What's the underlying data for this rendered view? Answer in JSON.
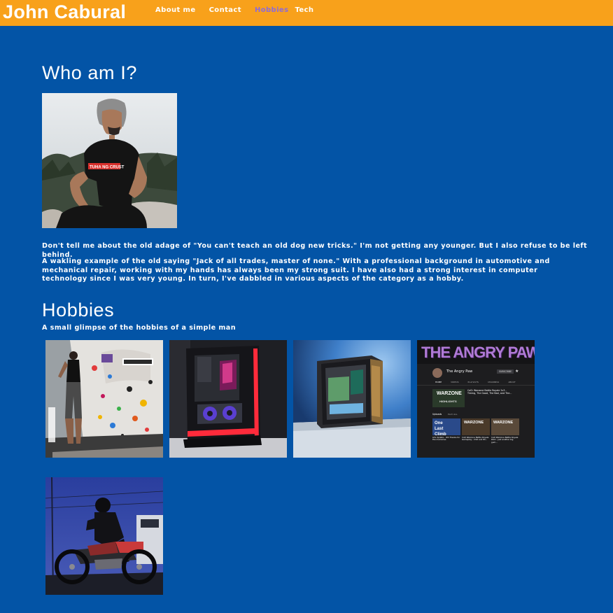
{
  "navbar": {
    "brand": "John Cabural",
    "links": [
      {
        "label": "About me"
      },
      {
        "label": "Contact"
      },
      {
        "label": "Hobbies"
      },
      {
        "label": "Tech"
      }
    ],
    "active_link_color": "#8c6bd8",
    "background_color": "#f8a11b"
  },
  "page": {
    "background_color": "#0354a6"
  },
  "about": {
    "title": "Who am I?",
    "portrait_shirt_text": "TUHA NG CRUST",
    "paragraph_1": "Don't tell me about the old adage of \"You can't teach an old dog new tricks.\" I'm not getting any younger. But I also refuse to be left behind.",
    "paragraph_2": "A wakling example of the old saying \"Jack of all trades, master of none.\" With a professional background in automotive and mechanical repair, working with my hands has always been my strong suit. I have also had a strong interest in computer technology since I was very young. In turn, I've dabbled in various aspects of the category as a hobby."
  },
  "hobbies": {
    "title": "Hobbies",
    "subtitle": "A small glimpse of the hobbies of a simple man",
    "channel": {
      "banner": "THE ANGRY PAW",
      "name": "The Angry Paw",
      "subscribe": "SUBSCRIBE",
      "tabs": [
        "HOME",
        "VIDEOS",
        "PLAYLISTS",
        "CHANNELS",
        "ABOUT"
      ],
      "featured_thumb": "WARZONE",
      "featured_thumb_sub": "HIGHLIGHTS",
      "featured_title": "CoD: Warzone Battle Royale 2v3 - Timing, The Good, The Bad, and The...",
      "uploads_label": "Uploads",
      "play_all": "PLAY ALL",
      "uploads": [
        {
          "thumb": "One Last Climb",
          "title": "Life Update - 4th Thanks for the memories"
        },
        {
          "thumb": "WARZONE",
          "title": "CoD Warzone Battle Royale Gameplay - Chill and Wi..."
        },
        {
          "thumb": "WARZONE",
          "title": "CoD Warzone Battle Royale DUO - Just another big gum..."
        }
      ]
    }
  }
}
